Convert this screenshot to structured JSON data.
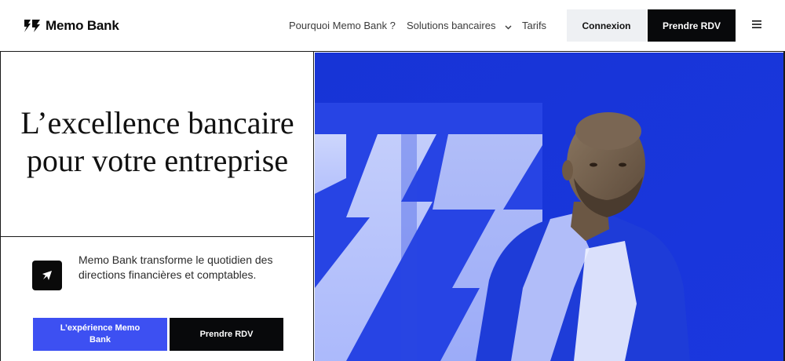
{
  "brand": {
    "name": "Memo Bank"
  },
  "nav": {
    "items": [
      {
        "label": "Pourquoi Memo Bank ?"
      },
      {
        "label": "Solutions bancaires"
      },
      {
        "label": "Tarifs"
      }
    ],
    "login_label": "Connexion",
    "appointment_label": "Prendre RDV"
  },
  "hero": {
    "headline": "L’excellence bancaire pour votre entreprise",
    "description": "Memo Bank transforme le quotidien des directions financières et comptables.",
    "primary_cta": "L’expérience Memo Bank",
    "secondary_cta": "Prendre RDV"
  },
  "colors": {
    "accent": "#3d50f2",
    "hero_background": "#1e35dc",
    "dark": "#08090b"
  },
  "icons": {
    "logo": "memo-bank-logo-icon",
    "menu": "hamburger-menu-icon",
    "chevron": "chevron-down-icon",
    "feature": "arrow-tilted-icon"
  }
}
